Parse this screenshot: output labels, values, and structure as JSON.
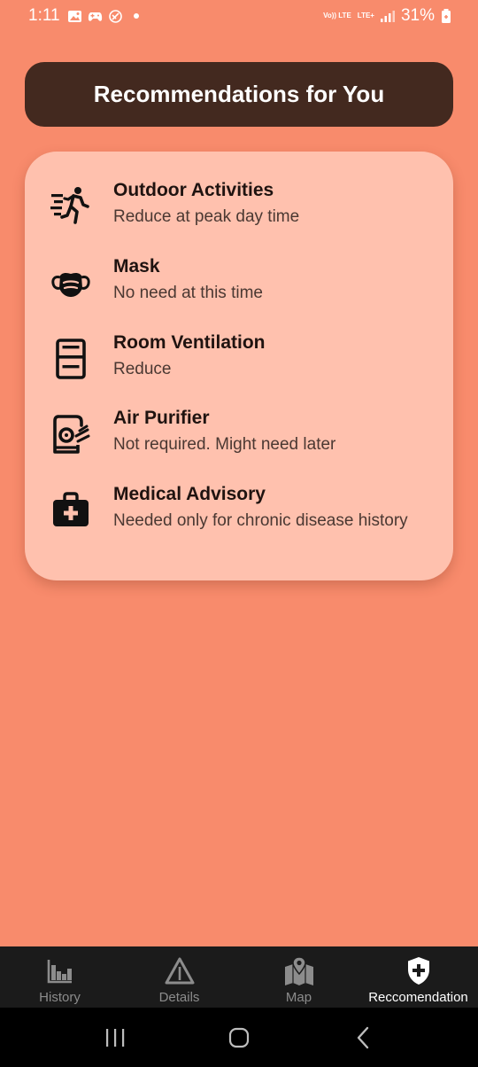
{
  "status_bar": {
    "time": "1:11",
    "volte_tag": "Vo)) LTE",
    "lte_tag": "LTE+",
    "battery_percent": "31%"
  },
  "header": {
    "title": "Recommendations for You"
  },
  "recommendations": [
    {
      "icon": "running-person-icon",
      "title": "Outdoor Activities",
      "subtitle": "Reduce at peak day time"
    },
    {
      "icon": "mask-icon",
      "title": "Mask",
      "subtitle": "No need at this time"
    },
    {
      "icon": "window-icon",
      "title": "Room Ventilation",
      "subtitle": "Reduce"
    },
    {
      "icon": "air-purifier-icon",
      "title": "Air Purifier",
      "subtitle": "Not required. Might need later"
    },
    {
      "icon": "medical-kit-icon",
      "title": "Medical Advisory",
      "subtitle": "Needed only for chronic disease history"
    }
  ],
  "bottom_nav": {
    "tabs": [
      {
        "icon": "bar-chart-icon",
        "label": "History",
        "active": false
      },
      {
        "icon": "warning-triangle-icon",
        "label": "Details",
        "active": false
      },
      {
        "icon": "map-icon",
        "label": "Map",
        "active": false
      },
      {
        "icon": "shield-plus-icon",
        "label": "Reccomendation",
        "active": true
      }
    ]
  },
  "colors": {
    "background": "#F88B6C",
    "header_bg": "#43291F",
    "card_bg": "#FFC1AE",
    "nav_bg": "#1B1B1B",
    "nav_inactive": "#8C8C8C",
    "nav_active": "#FFFFFF"
  }
}
